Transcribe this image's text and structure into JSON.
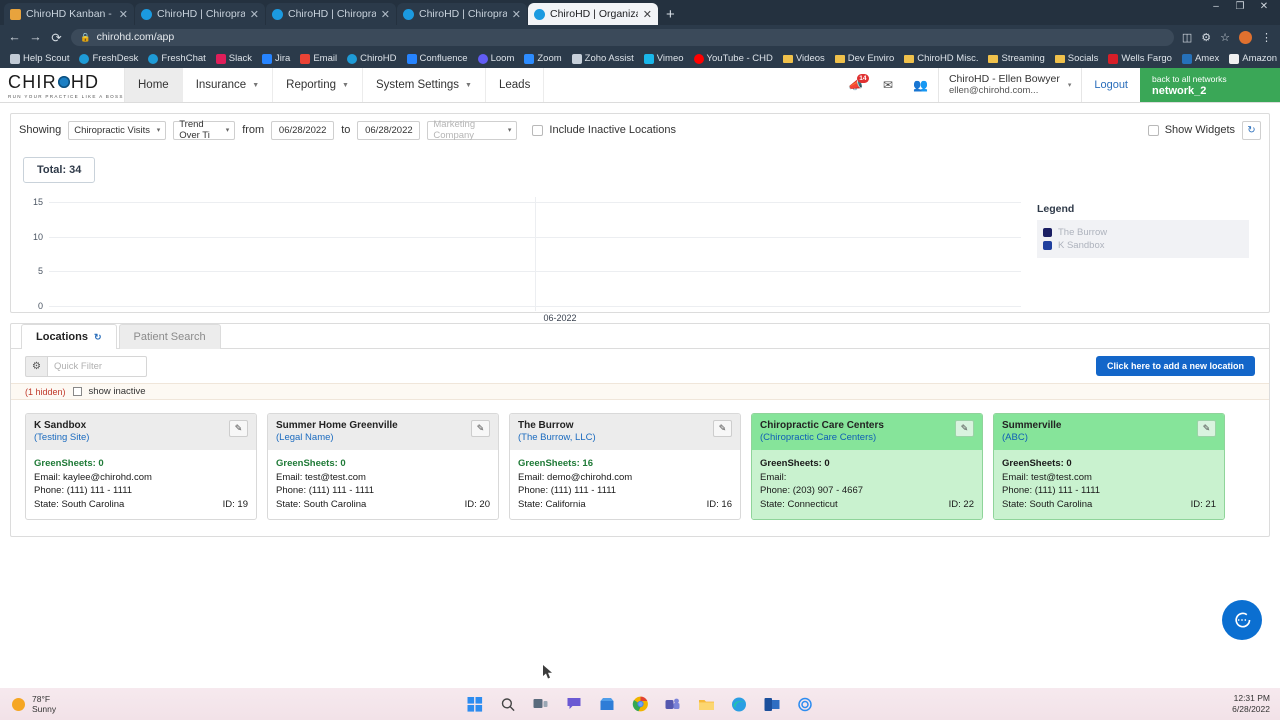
{
  "browser": {
    "tabs": [
      {
        "label": "ChiroHD Kanban - Agile Board -",
        "favicon": "#e8a33d",
        "active": false
      },
      {
        "label": "ChiroHD | Chiropractic Office Ma",
        "favicon": "#1b9ae0",
        "active": false
      },
      {
        "label": "ChiroHD | Chiropractic Office Ma",
        "favicon": "#1b9ae0",
        "active": false
      },
      {
        "label": "ChiroHD | Chiropractic Office Ma",
        "favicon": "#1b9ae0",
        "active": false
      },
      {
        "label": "ChiroHD | Organization Home",
        "favicon": "#1b9ae0",
        "active": true
      }
    ],
    "new_tab_label": "+",
    "close_label": "✕",
    "url": "chirohd.com/app",
    "lock_icon": "lock-icon",
    "nav": {
      "back": "←",
      "forward": "→",
      "reload": "⟳"
    },
    "toolbar_right": [
      "cast-icon",
      "extensions-icon",
      "star-icon",
      "profile-avatar",
      "menu-icon"
    ],
    "window_controls": [
      "–",
      "❐",
      "✕"
    ],
    "bookmarks": [
      {
        "label": "Help Scout",
        "icon": "#c2cbd6",
        "type": "site"
      },
      {
        "label": "FreshDesk",
        "icon": "#1e9bd7",
        "type": "site"
      },
      {
        "label": "FreshChat",
        "icon": "#1e9bd7",
        "type": "site"
      },
      {
        "label": "Slack",
        "icon": "#e01e5a",
        "type": "site"
      },
      {
        "label": "Jira",
        "icon": "#2684ff",
        "type": "site"
      },
      {
        "label": "Email",
        "icon": "#ea4335",
        "type": "site"
      },
      {
        "label": "ChiroHD",
        "icon": "#1e9bd7",
        "type": "site"
      },
      {
        "label": "Confluence",
        "icon": "#2684ff",
        "type": "site"
      },
      {
        "label": "Loom",
        "icon": "#625df5",
        "type": "site"
      },
      {
        "label": "Zoom",
        "icon": "#2d8cff",
        "type": "site"
      },
      {
        "label": "Zoho Assist",
        "icon": "#c7d0da",
        "type": "site"
      },
      {
        "label": "Vimeo",
        "icon": "#1ab7ea",
        "type": "site"
      },
      {
        "label": "YouTube - CHD",
        "icon": "#ff0000",
        "type": "site"
      },
      {
        "label": "Videos",
        "icon": "#f0c14b",
        "type": "folder"
      },
      {
        "label": "Dev Enviro",
        "icon": "#f0c14b",
        "type": "folder"
      },
      {
        "label": "ChiroHD Misc.",
        "icon": "#f0c14b",
        "type": "folder"
      },
      {
        "label": "Streaming",
        "icon": "#f0c14b",
        "type": "folder"
      },
      {
        "label": "Socials",
        "icon": "#f0c14b",
        "type": "folder"
      },
      {
        "label": "Wells Fargo",
        "icon": "#d71e28",
        "type": "site"
      },
      {
        "label": "Amex",
        "icon": "#2671b9",
        "type": "site"
      },
      {
        "label": "Amazon",
        "icon": "#232f3e",
        "type": "site"
      }
    ]
  },
  "app": {
    "logo": {
      "wordmark_left": "CHIR",
      "wordmark_right": "HD",
      "tagline": "RUN YOUR PRACTICE LIKE A BOSS"
    },
    "nav_items": [
      {
        "label": "Home",
        "caret": false,
        "active": true
      },
      {
        "label": "Insurance",
        "caret": true,
        "active": false
      },
      {
        "label": "Reporting",
        "caret": true,
        "active": false
      },
      {
        "label": "System Settings",
        "caret": true,
        "active": false
      },
      {
        "label": "Leads",
        "caret": false,
        "active": false
      }
    ],
    "nav_right": {
      "announce_icon": "megaphone-icon",
      "announce_badge": "14",
      "mail_icon": "envelope-icon",
      "people_icon": "people-icon",
      "user_name": "ChiroHD - Ellen Bowyer",
      "user_email": "ellen@chirohd.com...",
      "user_caret": "▾",
      "logout_label": "Logout",
      "network_top": "back to all networks",
      "network_name": "network_2"
    }
  },
  "filters": {
    "showing_label": "Showing",
    "metric": "Chiropractic Visits",
    "mode": "Trend Over Ti",
    "from_label": "from",
    "from_value": "06/28/2022",
    "to_label": "to",
    "to_value": "06/28/2022",
    "marketing_placeholder": "Marketing Company",
    "include_inactive_label": "Include Inactive Locations",
    "show_widgets_label": "Show Widgets",
    "refresh_icon": "refresh-icon"
  },
  "summary": {
    "total_label": "Total: 34"
  },
  "chart_data": {
    "type": "line",
    "title": "",
    "xlabel": "",
    "ylabel": "",
    "x": [
      "06-2022"
    ],
    "ylim": [
      0,
      15
    ],
    "yticks": [
      0,
      5,
      10,
      15
    ],
    "grid": true,
    "legend_position": "right",
    "legend_title": "Legend",
    "series": [
      {
        "name": "The Burrow",
        "color": "#1b1f63",
        "values": [
          null
        ]
      },
      {
        "name": "K Sandbox",
        "color": "#1f3f9e",
        "values": [
          null
        ]
      }
    ]
  },
  "locations_panel": {
    "tabs": [
      {
        "label": "Locations",
        "icon": "refresh-icon",
        "active": true
      },
      {
        "label": "Patient Search",
        "icon": "",
        "active": false
      }
    ],
    "gear_icon": "gear-icon",
    "quick_filter_placeholder": "Quick Filter",
    "add_button_label": "Click here to add a new location",
    "hidden_label": "(1 hidden)",
    "show_inactive_label": "show inactive",
    "field_labels": {
      "greensheets": "GreenSheets:",
      "email": "Email:",
      "phone": "Phone:",
      "state": "State:",
      "id": "ID:"
    },
    "edit_icon": "edit-icon",
    "cards": [
      {
        "name": "K Sandbox",
        "legal": "(Testing Site)",
        "greensheets": "0",
        "email": "kaylee@chirohd.com",
        "phone": "(111) 111 - 1111",
        "state": "South Carolina",
        "id": "19",
        "highlight": false
      },
      {
        "name": "Summer Home Greenville",
        "legal": "(Legal Name)",
        "greensheets": "0",
        "email": "test@test.com",
        "phone": "(111) 111 - 1111",
        "state": "South Carolina",
        "id": "20",
        "highlight": false
      },
      {
        "name": "The Burrow",
        "legal": "(The Burrow, LLC)",
        "greensheets": "16",
        "email": "demo@chirohd.com",
        "phone": "(111) 111 - 1111",
        "state": "California",
        "id": "16",
        "highlight": false
      },
      {
        "name": "Chiropractic Care Centers",
        "legal": "(Chiropractic Care Centers)",
        "greensheets": "0",
        "email": "",
        "phone": "(203) 907 - 4667",
        "state": "Connecticut",
        "id": "22",
        "highlight": true
      },
      {
        "name": "Summerville",
        "legal": "(ABC)",
        "greensheets": "0",
        "email": "test@test.com",
        "phone": "(111) 111 - 1111",
        "state": "South Carolina",
        "id": "21",
        "highlight": true
      }
    ]
  },
  "chat_widget": {
    "icon": "chat-bubble-icon",
    "color": "#0b6fd1"
  },
  "taskbar": {
    "weather_temp": "78°F",
    "weather_desc": "Sunny",
    "clock_time": "12:31 PM",
    "clock_date": "6/28/2022",
    "icons": [
      "start-icon",
      "search-icon",
      "taskview-icon",
      "chat-icon",
      "store-icon",
      "chrome-icon",
      "teams-icon",
      "explorer-icon",
      "edge-icon",
      "outlook-icon",
      "settings-icon"
    ]
  }
}
